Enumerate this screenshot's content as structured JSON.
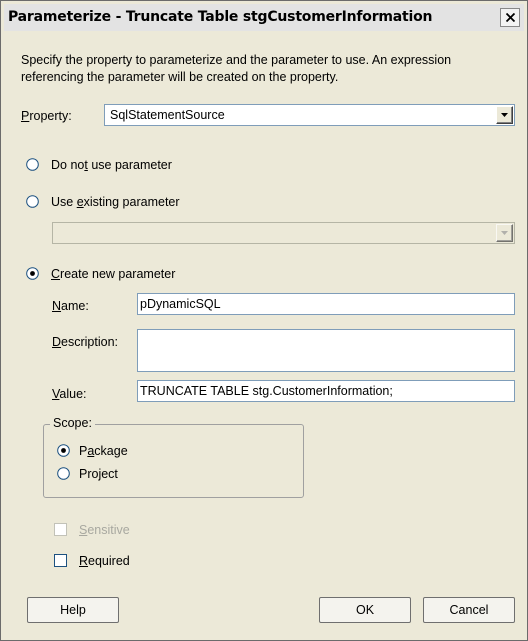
{
  "dialog": {
    "title": "Parameterize - Truncate Table stgCustomerInformation",
    "description": "Specify the property to parameterize and the parameter to use. An expression referencing the parameter will be created on the property."
  },
  "property": {
    "label_pre": "",
    "label_key": "P",
    "label_post": "roperty:",
    "value": "SqlStatementSource"
  },
  "options": {
    "do_not_use": {
      "pre": "Do no",
      "key": "t",
      "post": " use parameter",
      "selected": false
    },
    "use_existing": {
      "pre": "Use ",
      "key": "e",
      "post": "xisting parameter",
      "selected": false,
      "combo_value": ""
    },
    "create_new": {
      "pre": "",
      "key": "C",
      "post": "reate new parameter",
      "selected": true
    }
  },
  "new_parameter": {
    "name_label": {
      "key": "N",
      "post": "ame:"
    },
    "name_value": "pDynamicSQL",
    "description_label": {
      "key": "D",
      "post": "escription:"
    },
    "description_value": "",
    "value_label": {
      "key": "V",
      "post": "alue:"
    },
    "value_value": "TRUNCATE TABLE stg.CustomerInformation;"
  },
  "scope": {
    "title": "Scope:",
    "package": {
      "pre": "P",
      "key": "a",
      "post": "ckage",
      "selected": true
    },
    "project": {
      "pre": "Pro",
      "key": "j",
      "post": "ect",
      "selected": false
    }
  },
  "flags": {
    "sensitive": {
      "key": "S",
      "post": "ensitive",
      "checked": false,
      "enabled": false
    },
    "required": {
      "key": "R",
      "post": "equired",
      "checked": false,
      "enabled": true
    }
  },
  "buttons": {
    "help": "Help",
    "ok": "OK",
    "cancel": "Cancel"
  }
}
